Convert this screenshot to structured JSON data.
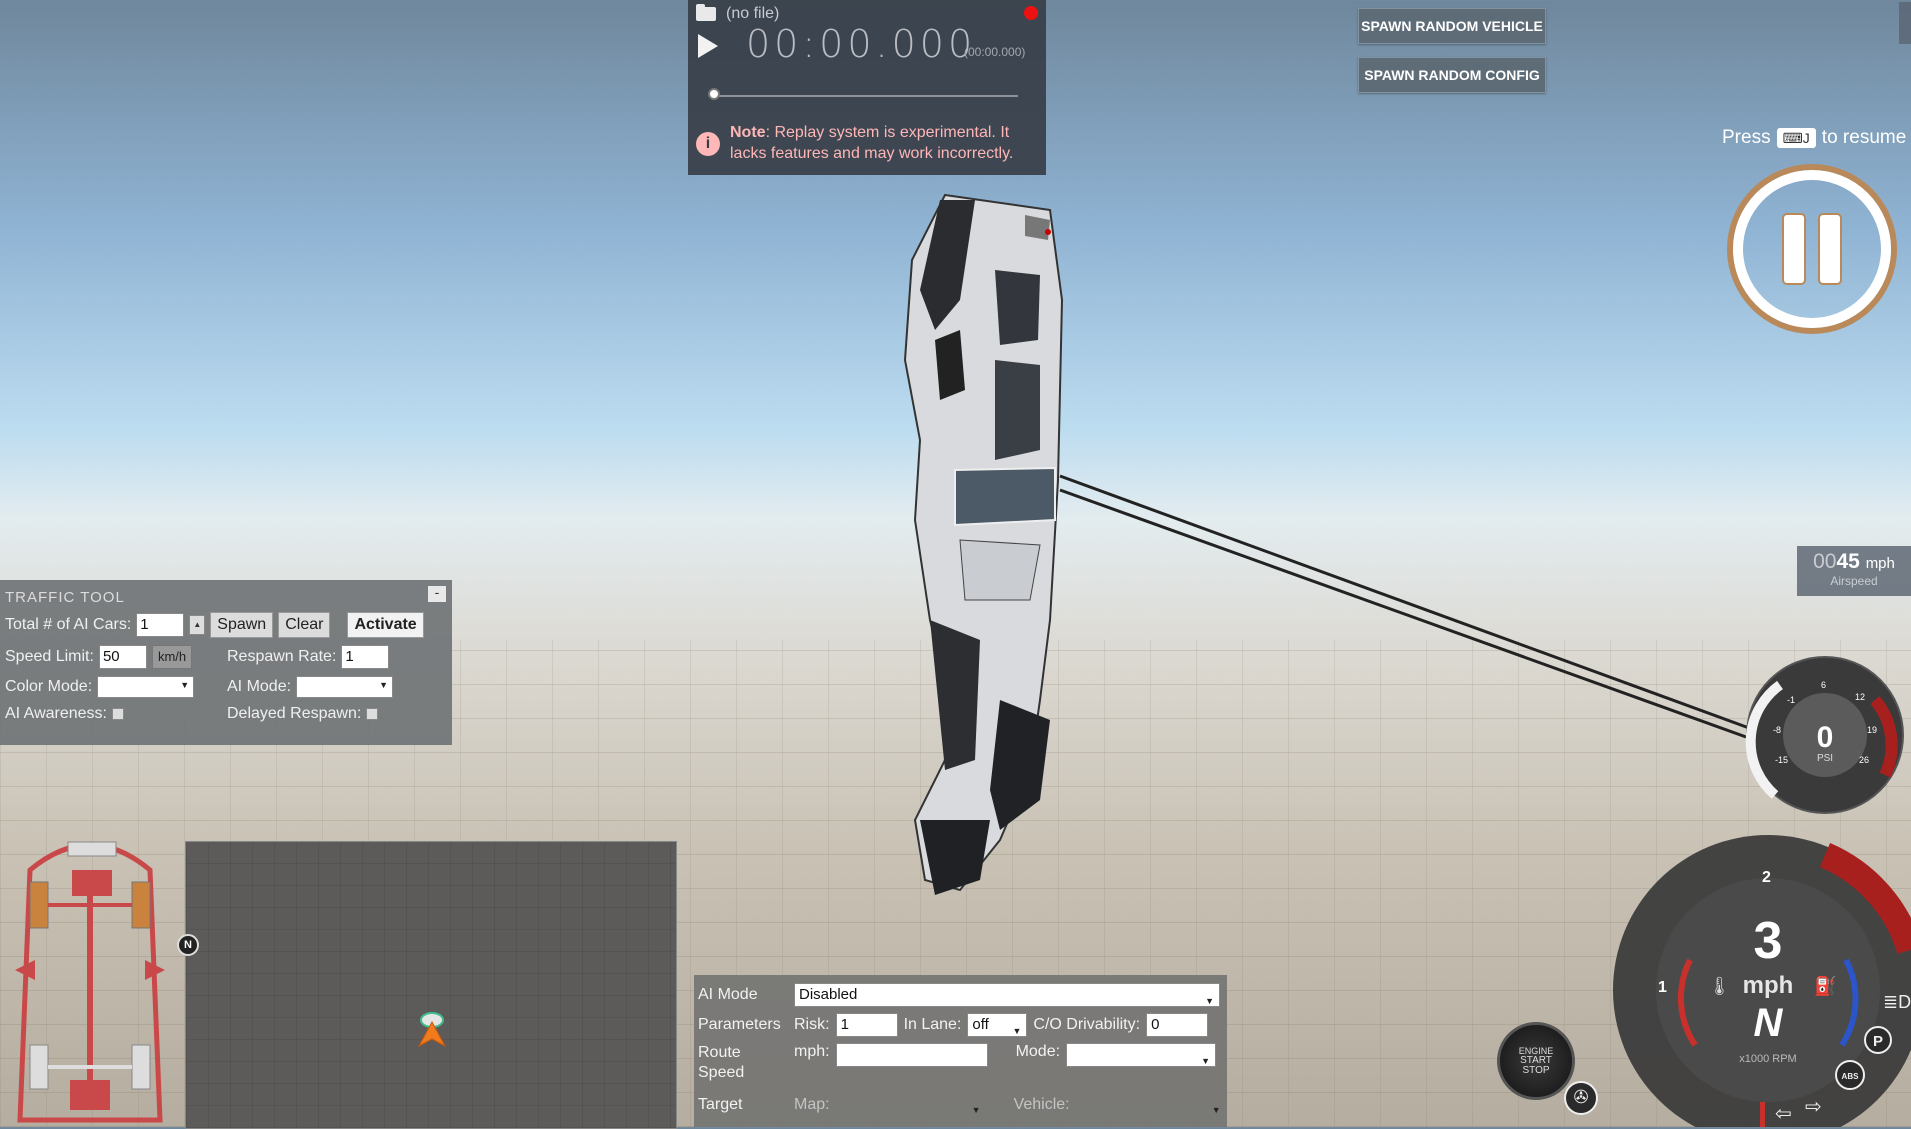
{
  "replay": {
    "file": "(no file)",
    "timecode": "00:00.000",
    "timecode_small": "(00:00.000)",
    "note_label": "Note",
    "note_text": ": Replay system is experimental. It lacks features and may work incorrectly.",
    "progress": 0
  },
  "buttons": {
    "spawn_vehicle": "SPAWN RANDOM VEHICLE",
    "spawn_config": "SPAWN RANDOM CONFIG"
  },
  "resume": {
    "press": "Press",
    "key": "J",
    "to_resume": "to resume"
  },
  "airspeed": {
    "prefix": "00",
    "value": "45",
    "unit": "mph",
    "label": "Airspeed"
  },
  "traffic_tool": {
    "title": "TRAFFIC TOOL",
    "minimize": "-",
    "total_label": "Total # of AI Cars:",
    "total_value": "1",
    "spawn": "Spawn",
    "clear": "Clear",
    "activate": "Activate",
    "speed_label": "Speed Limit:",
    "speed_value": "50",
    "speed_unit": "km/h",
    "respawn_label": "Respawn Rate:",
    "respawn_value": "1",
    "color_label": "Color Mode:",
    "ai_mode_label": "AI Mode:",
    "awareness_label": "AI Awareness:",
    "delayed_label": "Delayed Respawn:"
  },
  "ai_panel": {
    "ai_mode_label": "AI Mode",
    "ai_mode_value": "Disabled",
    "params_label": "Parameters",
    "risk_label": "Risk:",
    "risk_value": "1",
    "inlane_label": "In Lane:",
    "inlane_value": "off",
    "drivability_label": "C/O Drivability:",
    "drivability_value": "0",
    "route_label": "Route Speed",
    "mph_label": "mph:",
    "mode_label": "Mode:",
    "target_label": "Target",
    "map_label": "Map:",
    "vehicle_label": "Vehicle:"
  },
  "boost_gauge": {
    "value": "0",
    "unit": "PSI",
    "ticks": [
      "-15",
      "-8",
      "-1",
      "6",
      "12",
      "19",
      "26"
    ]
  },
  "speedo": {
    "speed": "3",
    "unit": "mph",
    "gear": "N",
    "rpm_label": "x1000 RPM",
    "ticks": [
      "1",
      "2"
    ],
    "rpm": 0
  },
  "map": {
    "north": "N"
  },
  "engine_button": {
    "line1": "ENGINE",
    "line2": "START",
    "line3": "STOP"
  },
  "indicators": {
    "park": "P",
    "abs": "ABS"
  },
  "colors": {
    "accent_red": "#e11111",
    "note_pink": "#ffb6b6",
    "pause_ring": "#b9895a"
  }
}
